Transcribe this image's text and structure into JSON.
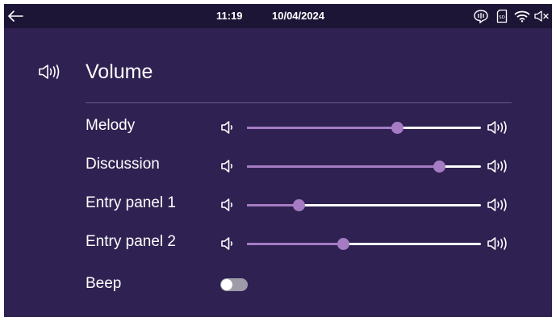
{
  "status_bar": {
    "time": "11:19",
    "date": "10/04/2024",
    "icons": [
      "back-arrow-icon",
      "intercom-icon",
      "sd-card-icon",
      "wifi-icon",
      "speaker-muted-icon"
    ]
  },
  "header": {
    "title": "Volume",
    "icon": "speaker-icon"
  },
  "settings": {
    "sliders": [
      {
        "label": "Melody",
        "value": 0.64
      },
      {
        "label": "Discussion",
        "value": 0.82
      },
      {
        "label": "Entry panel 1",
        "value": 0.22
      },
      {
        "label": "Entry panel 2",
        "value": 0.41
      }
    ],
    "beep": {
      "label": "Beep",
      "enabled": false
    }
  },
  "colors": {
    "background": "#2f2151",
    "status_bar": "#1d1536",
    "accent": "#a57cc4",
    "toggle_off": "#9e9aa8"
  }
}
